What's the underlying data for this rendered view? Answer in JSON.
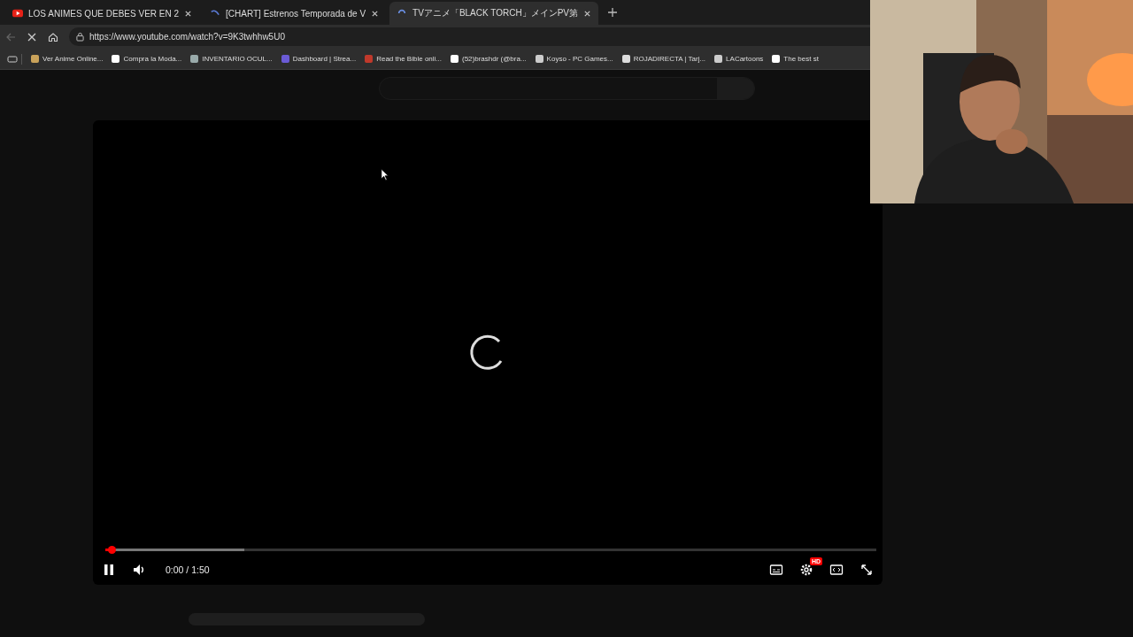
{
  "tabs": [
    {
      "title": "LOS ANIMES QUE DEBES VER EN 2",
      "selected": false
    },
    {
      "title": "[CHART] Estrenos Temporada de V",
      "selected": false
    },
    {
      "title": "TVアニメ「BLACK TORCH」メインPV第",
      "selected": true
    }
  ],
  "address_bar": {
    "url": "https://www.youtube.com/watch?v=9K3twhhw5U0"
  },
  "bookmarks": [
    {
      "label": "Ver Anime Online..."
    },
    {
      "label": "Compra la Moda..."
    },
    {
      "label": "INVENTARIO OCUL..."
    },
    {
      "label": "Dashboard | Strea..."
    },
    {
      "label": "Read the Bible onli..."
    },
    {
      "label": "(52)brashdr (@bra..."
    },
    {
      "label": "Koyso - PC Games..."
    },
    {
      "label": "ROJADIRECTA | Tarj..."
    },
    {
      "label": "LACartoons"
    },
    {
      "label": "The best st"
    }
  ],
  "player": {
    "played": {
      "level": 0.003
    },
    "buffered": {
      "level": 0.18
    },
    "time": "0:00 / 1:50",
    "quality_badge": "HD"
  }
}
